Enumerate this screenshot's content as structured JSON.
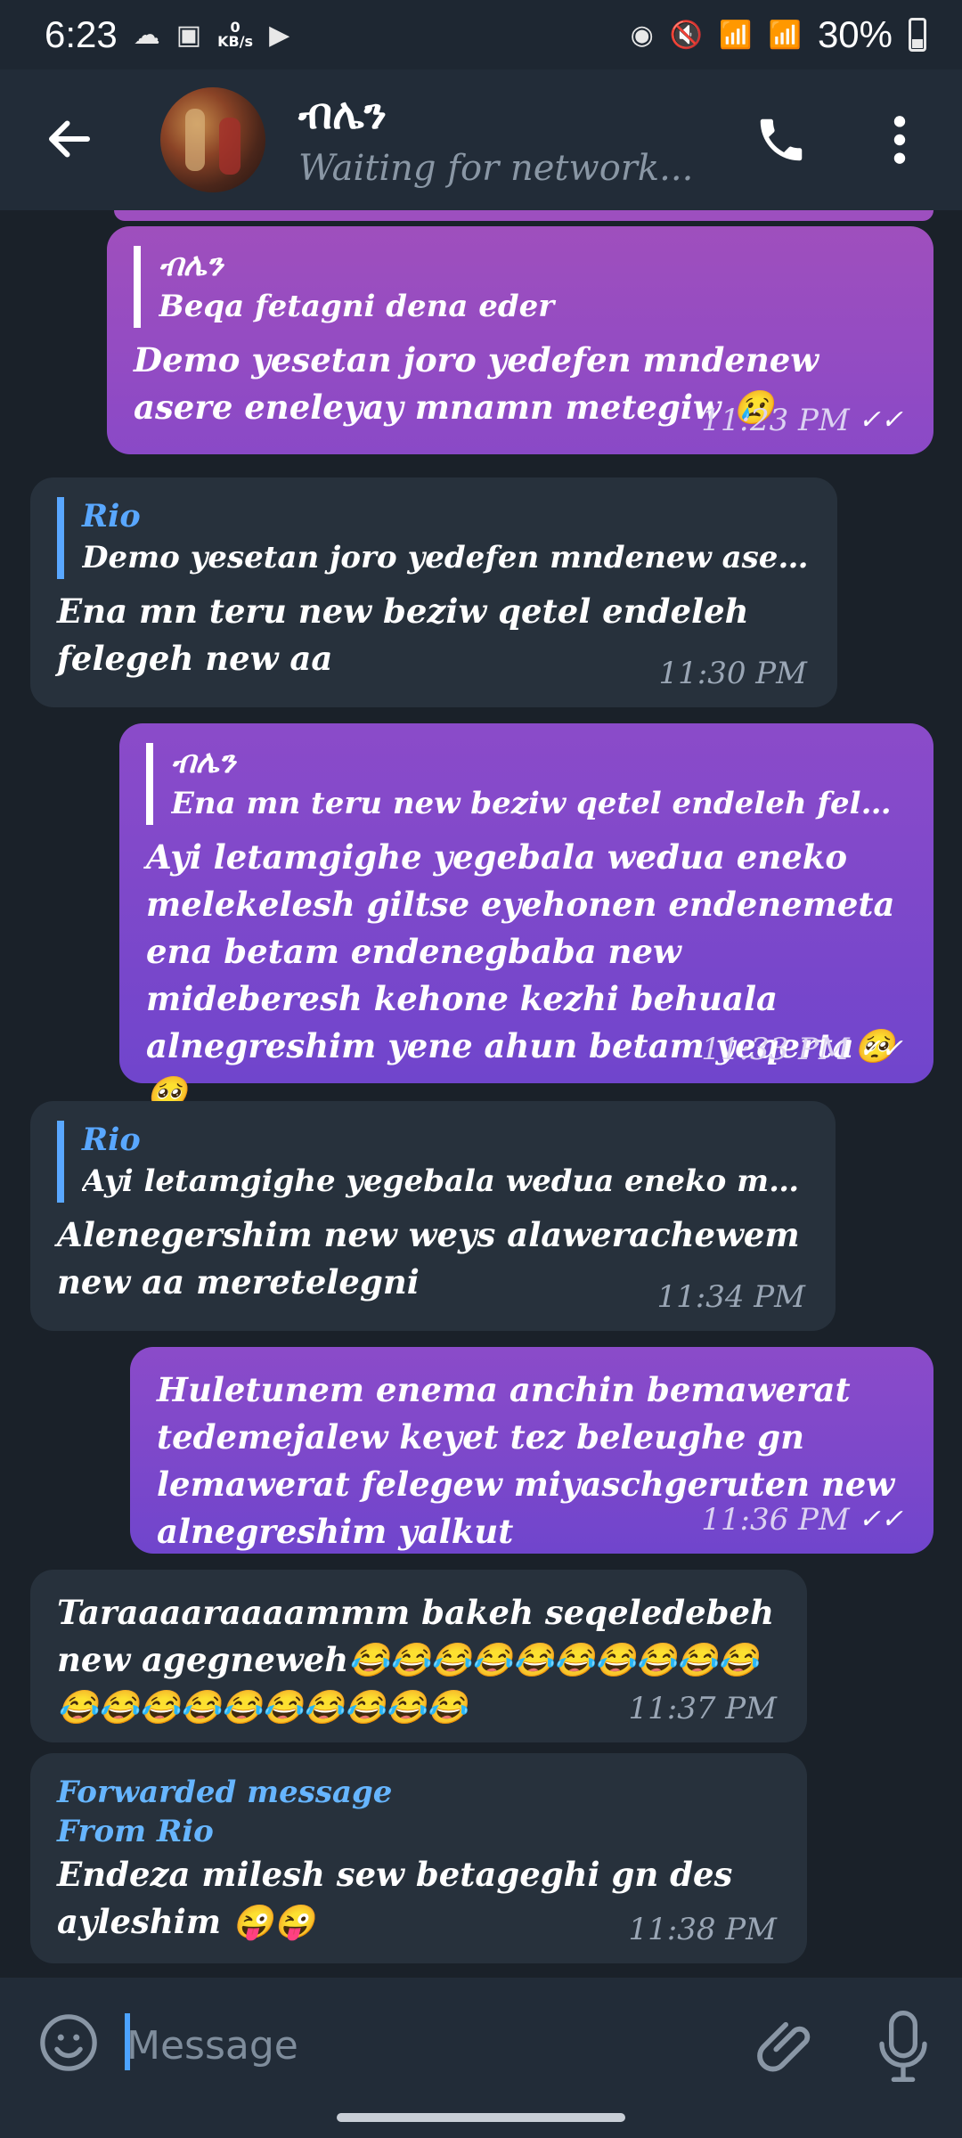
{
  "status_bar": {
    "time": "6:23",
    "network_speed": "0",
    "network_unit": "KB/s",
    "battery": "30%"
  },
  "header": {
    "title": "ብሌን",
    "status": "Waiting for network..."
  },
  "messages": [
    {
      "direction": "out",
      "reply_name": "ብሌን",
      "reply_text": "Beqa fetagni dena eder",
      "text": "Demo yesetan joro yedefen mndenew asere eneleyay mnamn metegiw 😢",
      "time": "11:23 PM",
      "status": "✓✓"
    },
    {
      "direction": "in",
      "reply_name": "Rio",
      "reply_text": "Demo yesetan joro yedefen mndenew asere eneleyay m...",
      "text": "Ena mn teru new beziw qetel endeleh felegeh new aa",
      "time": "11:30 PM"
    },
    {
      "direction": "out",
      "reply_name": "ብሌን",
      "reply_text": "Ena mn teru new beziw qetel endeleh felegeh new aa",
      "text": "Ayi letamgighe yegebala wedua eneko melekelesh giltse eyehonen endenemeta ena betam endenegbaba new mideberesh kehone kezhi behuala alnegreshim yene ahun betam yeqerta🥺🥺",
      "time": "11:33 PM",
      "status": "✓✓"
    },
    {
      "direction": "in",
      "reply_name": "Rio",
      "reply_text": "Ayi letamgighe yegebala wedua eneko melekelesh giltse...",
      "text": "Alenegershim new weys alawerachewem new aa meretelegni",
      "time": "11:34 PM"
    },
    {
      "direction": "out",
      "text": "Huletunem enema anchin bemawerat tedemejalew keyet tez beleughe gn lemawerat felegew miyaschgeruten new alnegreshim yalkut",
      "time": "11:36 PM",
      "status": "✓✓"
    },
    {
      "direction": "in",
      "text": "Taraaaaraaaammm bakeh seqeledebeh new agegneweh😂😂😂😂😂😂😂😂😂😂😂😂😂😂😂😂😂😂😂😂",
      "time": "11:37 PM"
    },
    {
      "direction": "in",
      "forwarded_label": "Forwarded message",
      "forwarded_from": "From Rio",
      "text": "Endeza milesh sew betageghi gn des ayleshim 😜😜",
      "time": "11:38 PM"
    }
  ],
  "composer": {
    "placeholder": "Message"
  },
  "icons": {
    "back": "arrow-left-icon",
    "call": "phone-icon",
    "menu": "more-vertical-icon",
    "emoji": "emoji-icon",
    "attach": "paperclip-icon",
    "mic": "microphone-icon"
  }
}
